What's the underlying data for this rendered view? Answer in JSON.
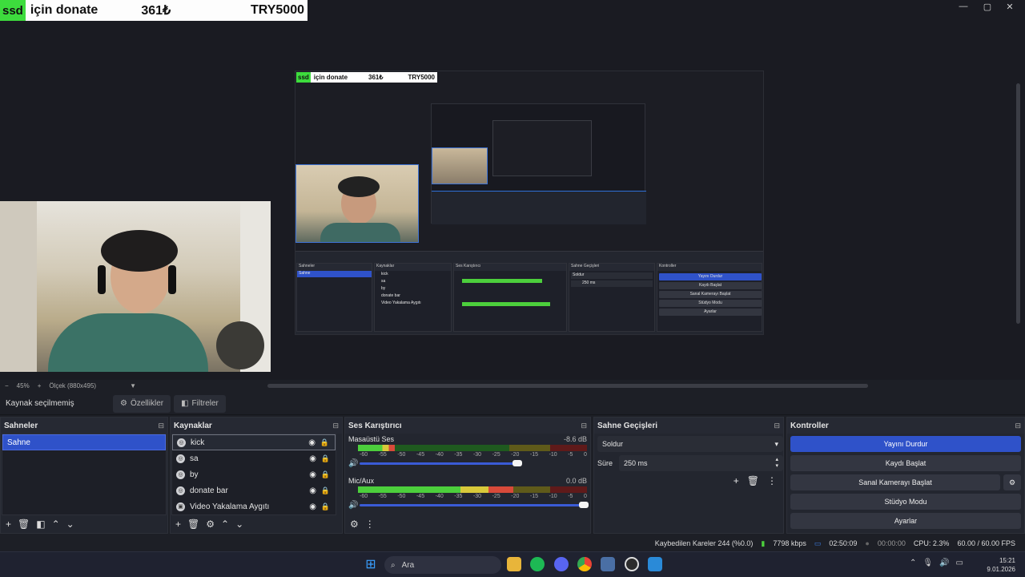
{
  "overlay": {
    "tag": "ssd",
    "text1": "için donate",
    "amount": "361₺",
    "total": "TRY5000"
  },
  "window_controls": {
    "minimize": "—",
    "maximize": "▢",
    "close": "✕"
  },
  "nested": {
    "tag": "ssd",
    "text1": "için donate",
    "amount": "361₺",
    "total": "TRY5000",
    "panels": {
      "scenes": "Sahneler",
      "sources": "Kaynaklar",
      "mixer": "Ses Karıştırıcı",
      "transitions": "Sahne Geçişleri",
      "controls": "Kontroller"
    },
    "scene": "Sahne",
    "sources": [
      "kick",
      "sa",
      "by",
      "donate bar",
      "Video Yakalama Aygıtı"
    ],
    "controls": [
      "Yayını Durdur",
      "Kaydı Başlat",
      "Sanal Kamerayı Başlat",
      "Stüdyo Modu",
      "Ayarlar"
    ],
    "transition": "Soldur",
    "duration": "250 ms"
  },
  "zoom": {
    "minus": "−",
    "value": "45%",
    "plus": "+",
    "scale": "Ölçek (880x495)",
    "caret": "▼"
  },
  "source_bar": {
    "label": "Kaynak seçilmemiş",
    "properties": "Özellikler",
    "filters": "Filtreler"
  },
  "scenes": {
    "title": "Sahneler",
    "items": [
      "Sahne"
    ]
  },
  "sources": {
    "title": "Kaynaklar",
    "items": [
      {
        "label": "kick",
        "icon": "globe-icon"
      },
      {
        "label": "sa",
        "icon": "globe-icon"
      },
      {
        "label": "by",
        "icon": "globe-icon"
      },
      {
        "label": "donate bar",
        "icon": "globe-icon"
      },
      {
        "label": "Video Yakalama Aygıtı",
        "icon": "camera-icon"
      }
    ]
  },
  "mixer": {
    "title": "Ses Karıştırıcı",
    "channels": [
      {
        "name": "Masaüstü Ses",
        "db": "-8.6 dB",
        "level": 0.16,
        "volume": 0.7
      },
      {
        "name": "Mic/Aux",
        "db": "0.0 dB",
        "level": 0.68,
        "volume": 1.0
      }
    ],
    "ticks": [
      "-60",
      "-55",
      "-50",
      "-45",
      "-40",
      "-35",
      "-30",
      "-25",
      "-20",
      "-15",
      "-10",
      "-5",
      "0"
    ]
  },
  "transitions": {
    "title": "Sahne Geçişleri",
    "type": "Soldur",
    "duration_label": "Süre",
    "duration": "250 ms"
  },
  "controls": {
    "title": "Kontroller",
    "stop_stream": "Yayını Durdur",
    "start_record": "Kaydı Başlat",
    "virtual_cam": "Sanal Kamerayı Başlat",
    "studio_mode": "Stüdyo Modu",
    "settings": "Ayarlar"
  },
  "status": {
    "dropped": "Kaybedilen Kareler 244 (%0.0)",
    "bitrate": "7798 kbps",
    "stream_time": "02:50:09",
    "record_time": "00:00:00",
    "cpu": "CPU: 2.3%",
    "fps": "60.00 / 60.00 FPS"
  },
  "taskbar": {
    "search": "Ara",
    "time": "15:21",
    "date": "9.01.2026"
  },
  "colors": {
    "accent": "#2f52c9",
    "panel": "#23262f",
    "bg": "#1d1f26",
    "green": "#3ddc3d"
  }
}
